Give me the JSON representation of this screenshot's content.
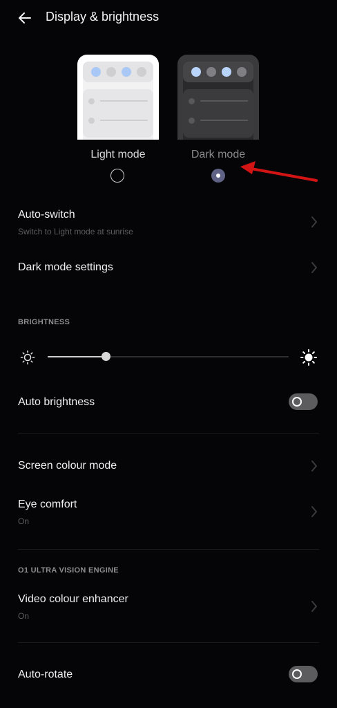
{
  "header": {
    "title": "Display & brightness"
  },
  "modes": {
    "light_label": "Light mode",
    "dark_label": "Dark mode",
    "selected": "Dark mode"
  },
  "rows": {
    "auto_switch": {
      "title": "Auto-switch",
      "subtitle": "Switch to Light mode at sunrise"
    },
    "dark_mode_settings": {
      "title": "Dark mode settings"
    },
    "auto_brightness": {
      "title": "Auto brightness"
    },
    "screen_colour_mode": {
      "title": "Screen colour mode"
    },
    "eye_comfort": {
      "title": "Eye comfort",
      "subtitle": "On"
    },
    "video_colour_enhancer": {
      "title": "Video colour enhancer",
      "subtitle": "On"
    },
    "auto_rotate": {
      "title": "Auto-rotate"
    }
  },
  "sections": {
    "brightness": "BRIGHTNESS",
    "engine": "O1 ULTRA VISION ENGINE"
  },
  "brightness": {
    "level": 0.24
  },
  "toggles": {
    "auto_brightness": false,
    "auto_rotate": false
  },
  "colors": {
    "background": "#050507",
    "selected_radio": "#5f6285",
    "annotation_arrow": "#d21414"
  },
  "icons": {
    "back": "arrow-left",
    "chevron": "chevron-right",
    "brightness_low": "sun-low",
    "brightness_high": "sun-high"
  }
}
